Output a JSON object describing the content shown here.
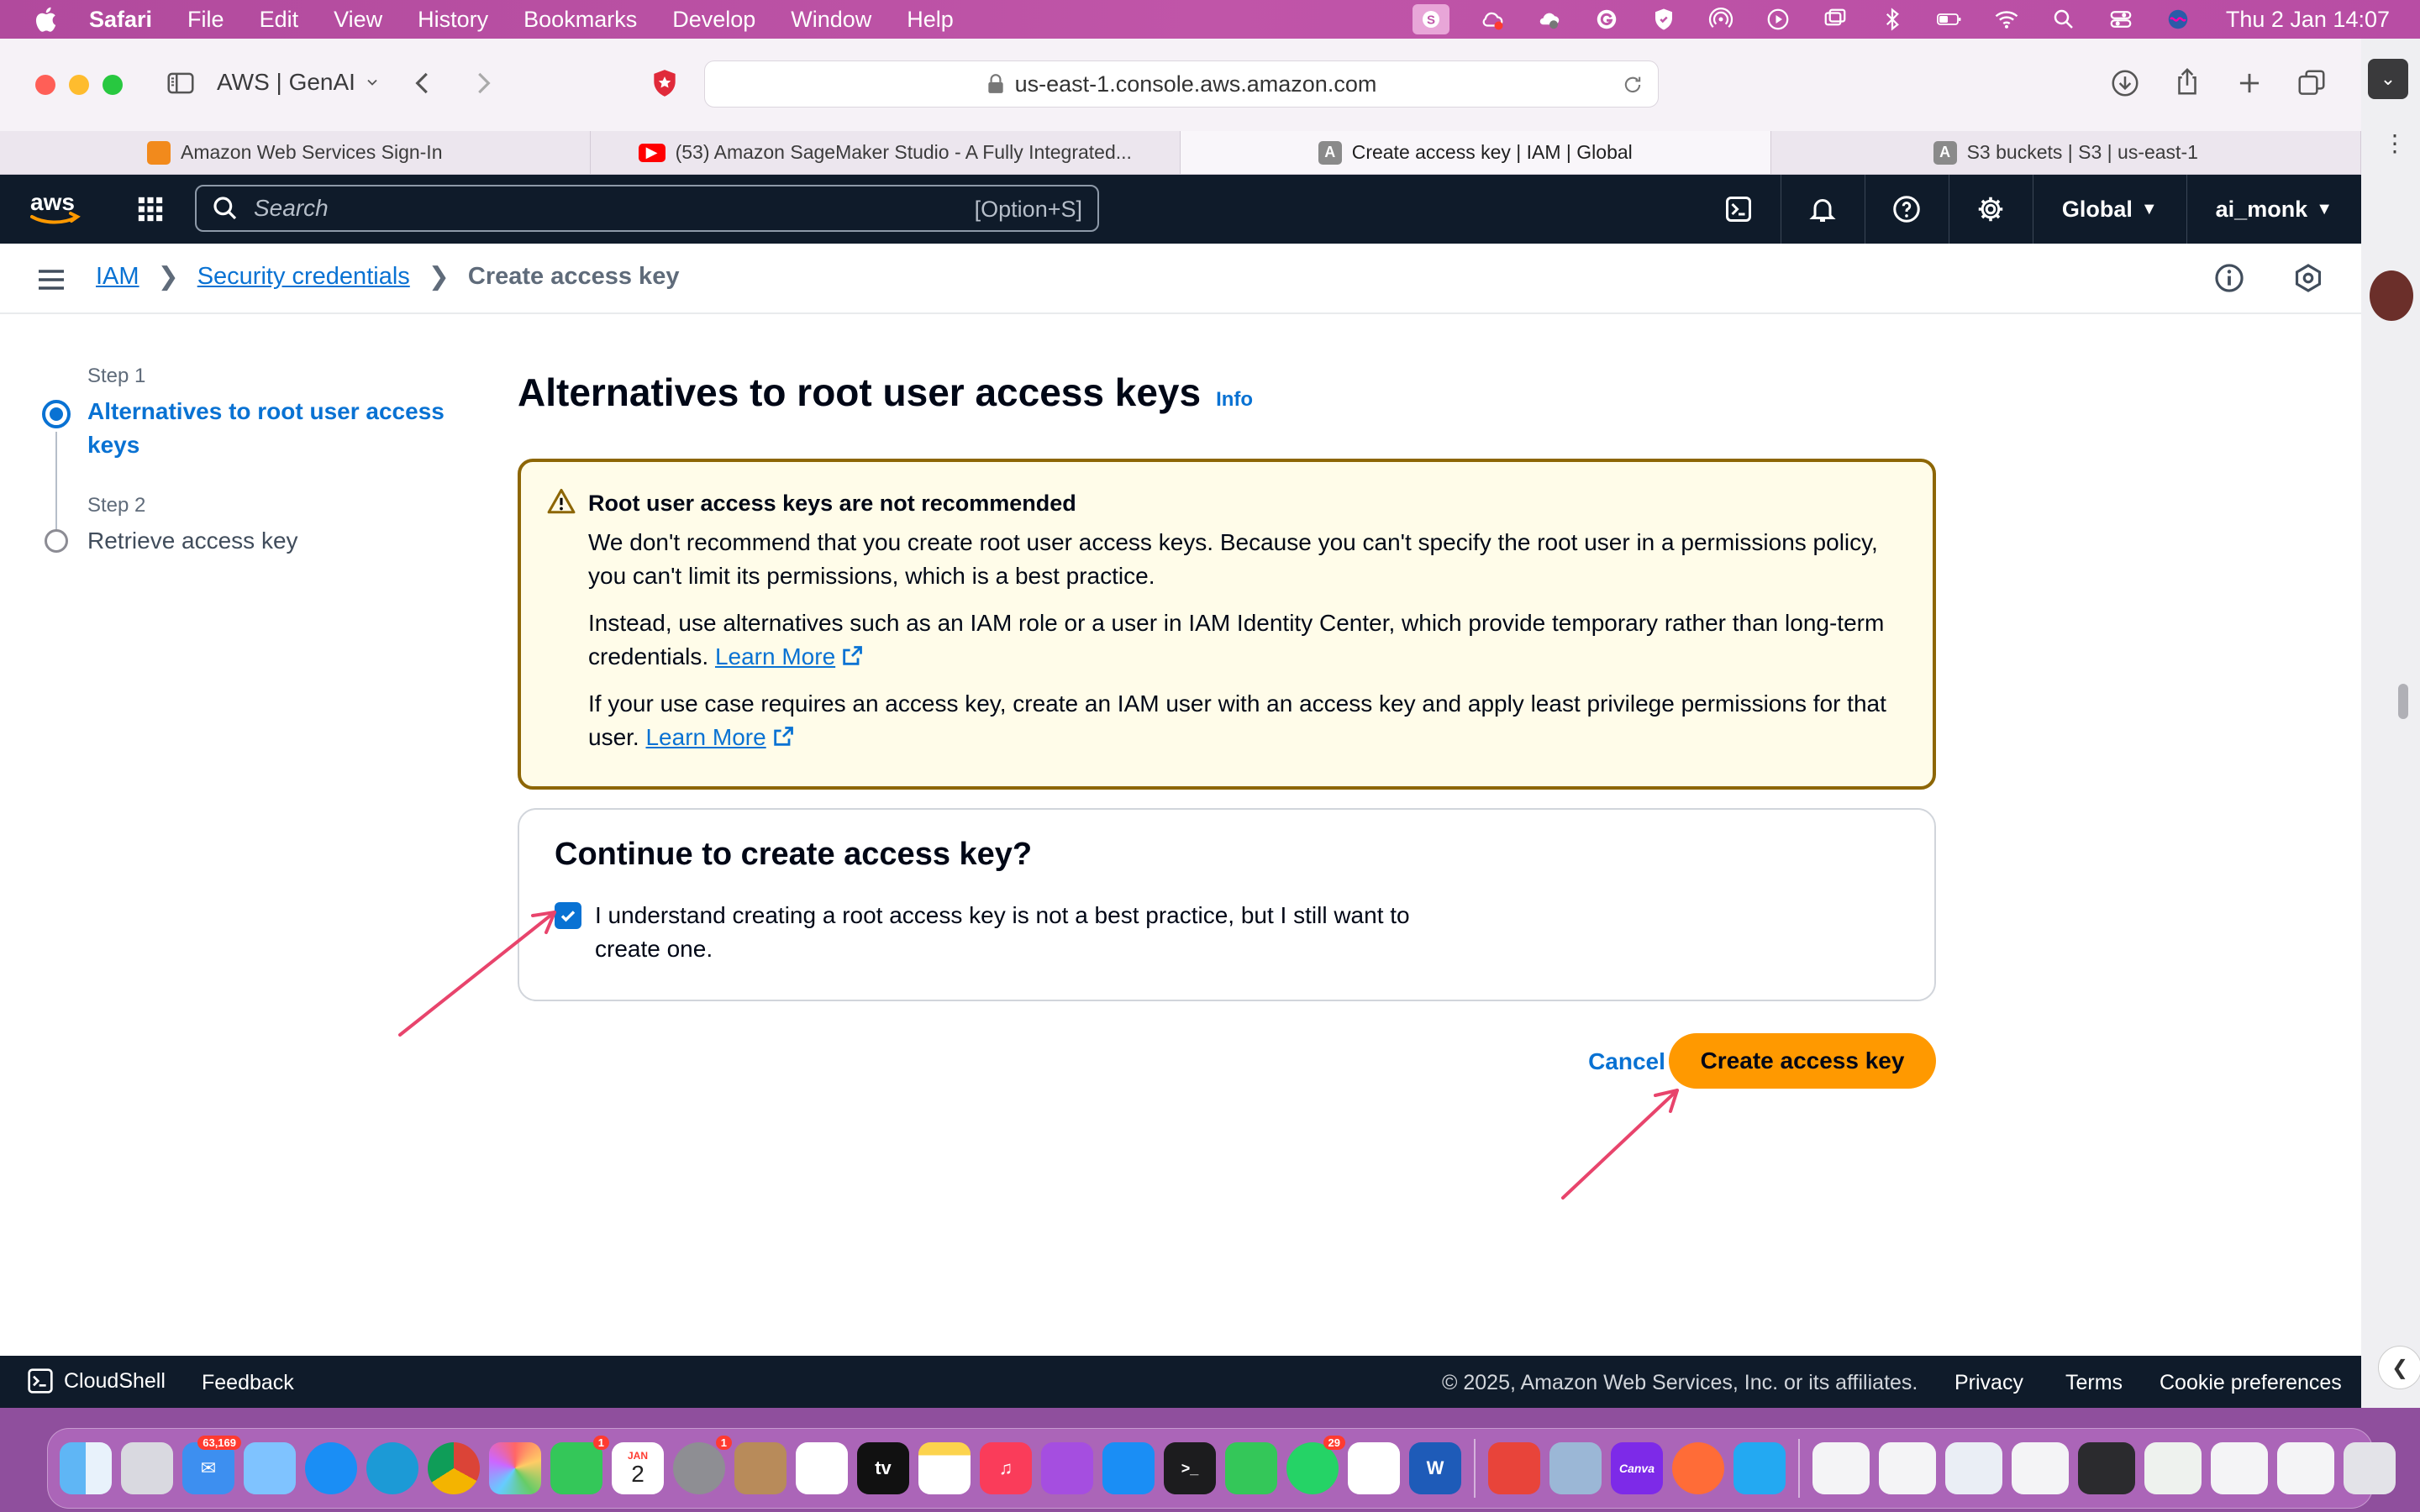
{
  "menubar": {
    "app": "Safari",
    "items": [
      "File",
      "Edit",
      "View",
      "History",
      "Bookmarks",
      "Develop",
      "Window",
      "Help"
    ],
    "clock": "Thu 2 Jan  14:07"
  },
  "browser": {
    "profile": "AWS | GenAI",
    "url": "us-east-1.console.aws.amazon.com",
    "tabs": [
      {
        "title": "Amazon Web Services Sign-In",
        "active": false
      },
      {
        "title": "(53) Amazon SageMaker Studio - A Fully Integrated...",
        "active": false
      },
      {
        "title": "Create access key | IAM | Global",
        "active": true
      },
      {
        "title": "S3 buckets | S3 | us-east-1",
        "active": false
      }
    ]
  },
  "aws": {
    "logo": "aws",
    "search_placeholder": "Search",
    "search_shortcut": "[Option+S]",
    "region": "Global",
    "user": "ai_monk"
  },
  "breadcrumb": {
    "items": [
      "IAM",
      "Security credentials"
    ],
    "current": "Create access key"
  },
  "wizard": {
    "steps": [
      {
        "label": "Step 1",
        "title": "Alternatives to root user access keys",
        "active": true
      },
      {
        "label": "Step 2",
        "title": "Retrieve access key",
        "active": false
      }
    ]
  },
  "page": {
    "title": "Alternatives to root user access keys",
    "info_link": "Info"
  },
  "alert": {
    "title": "Root user access keys are not recommended",
    "p1": "We don't recommend that you create root user access keys. Because you can't specify the root user in a permissions policy, you can't limit its permissions, which is a best practice.",
    "p2": "Instead, use alternatives such as an IAM role or a user in IAM Identity Center, which provide temporary rather than long-term credentials.",
    "p3": "If your use case requires an access key, create an IAM user with an access key and apply least privilege permissions for that user.",
    "learn_more": "Learn More"
  },
  "confirm": {
    "heading": "Continue to create access key?",
    "checkbox_label": "I understand creating a root access key is not a best practice, but I still want to create one.",
    "checked": true
  },
  "actions": {
    "cancel": "Cancel",
    "create": "Create access key"
  },
  "footer": {
    "cloudshell": "CloudShell",
    "feedback": "Feedback",
    "copyright": "© 2025, Amazon Web Services, Inc. or its affiliates.",
    "links": [
      "Privacy",
      "Terms",
      "Cookie preferences"
    ]
  },
  "dock": {
    "badges": {
      "mail": "63,169",
      "messages": "1",
      "settings": "1",
      "whatsapp": "29"
    },
    "calendar": {
      "month": "JAN",
      "day": "2"
    },
    "tv_label": "tv",
    "canva_label": "Canva",
    "word_label": "W"
  },
  "colors": {
    "aws_nav": "#0f1b2a",
    "link": "#0972d3",
    "primary_button": "#ff9900",
    "alert_border": "#8d6605",
    "alert_bg": "#fffce9",
    "annotation_arrow": "#e8446c"
  }
}
